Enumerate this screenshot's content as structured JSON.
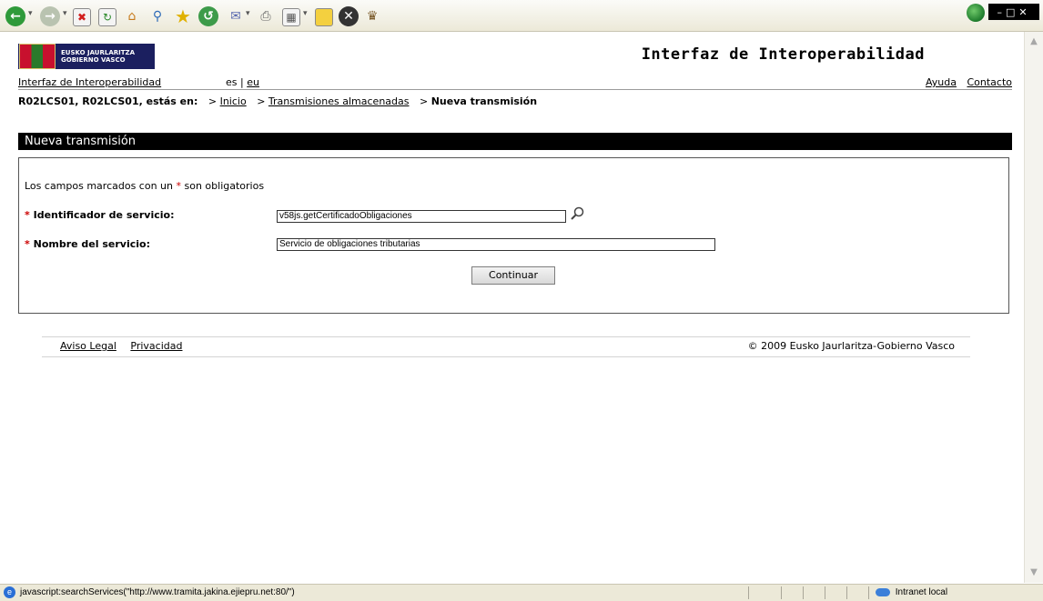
{
  "browser": {
    "toolbar_icons": [
      "back-icon",
      "forward-icon",
      "stop-icon",
      "refresh-icon",
      "home-icon",
      "search-icon",
      "favorites-icon",
      "history-icon",
      "mail-icon",
      "print-icon",
      "edit-icon",
      "notes-icon",
      "close-icon",
      "messenger-icon"
    ],
    "status_text": "javascript:searchServices(\"http://www.tramita.jakina.ejiepru.net:80/\")",
    "zone_text": "Intranet local"
  },
  "header": {
    "logo_line1": "EUSKO JAURLARITZA",
    "logo_line2": "GOBIERNO VASCO",
    "app_title": "Interfaz de Interoperabilidad"
  },
  "nav": {
    "home_link": "Interfaz de Interoperabilidad",
    "lang_es": "es",
    "lang_sep": "|",
    "lang_eu": "eu",
    "help": "Ayuda",
    "contact": "Contacto"
  },
  "breadcrumb": {
    "user": "R02LCS01, R02LCS01, estás en:",
    "items": [
      {
        "prefix": ">",
        "label": "Inicio"
      },
      {
        "prefix": ">",
        "label": "Transmisiones almacenadas"
      },
      {
        "prefix": ">",
        "label": "Nueva transmisión"
      }
    ]
  },
  "section": {
    "title": "Nueva transmisión"
  },
  "form": {
    "required_note_pre": "Los campos marcados con un",
    "required_star": "*",
    "required_note_post": "son obligatorios",
    "service_id_label": "Identificador de servicio:",
    "service_id_value": "v58js.getCertificadoObligaciones",
    "service_name_label": "Nombre del servicio:",
    "service_name_value": "Servicio de obligaciones tributarias",
    "continue_label": "Continuar"
  },
  "footer": {
    "legal": "Aviso Legal",
    "privacy": "Privacidad",
    "copyright": "© 2009 Eusko Jaurlaritza-Gobierno Vasco"
  },
  "colors": {
    "accent": "#000000",
    "required": "#cc0000",
    "logo_bg": "#1b1f5f"
  }
}
